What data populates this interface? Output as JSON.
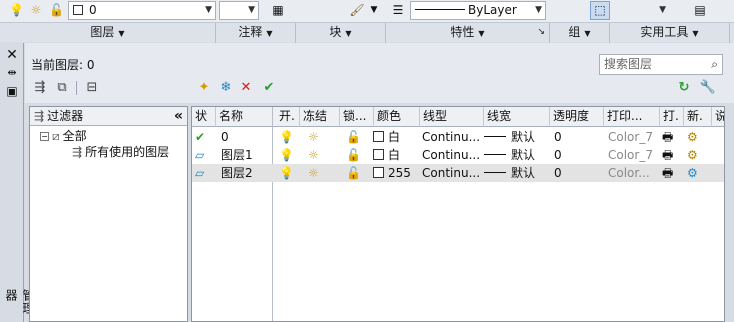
{
  "ribbon": {
    "layer_dropdown_value": "0",
    "linetype_value": "ByLayer",
    "sections": {
      "layers": "图层",
      "annotation": "注释",
      "block": "块",
      "properties": "特性",
      "groups": "组",
      "utilities": "实用工具"
    }
  },
  "manager": {
    "current_layer": "当前图层: 0",
    "search_placeholder": "搜索图层",
    "side_title": "图层特性管理器"
  },
  "filter_tree": {
    "header": "过滤器",
    "collapse": "«",
    "nodes": [
      {
        "label": "全部",
        "expander": "−"
      },
      {
        "label": "所有使用的图层"
      }
    ]
  },
  "layer_table": {
    "columns": [
      "状",
      "名称",
      "开.",
      "冻结",
      "锁...",
      "颜色",
      "线型",
      "线宽",
      "透明度",
      "打印...",
      "打.",
      "新.",
      "说"
    ],
    "rows": [
      {
        "status": "current",
        "name": "0",
        "color": "白",
        "linetype": "Continu...",
        "lineweight": "默认",
        "transparency": "0",
        "plot_style": "Color_7"
      },
      {
        "status": "normal",
        "name": "图层1",
        "color": "白",
        "linetype": "Continu...",
        "lineweight": "默认",
        "transparency": "0",
        "plot_style": "Color_7"
      },
      {
        "status": "normal",
        "name": "图层2",
        "color": "255",
        "linetype": "Continu...",
        "lineweight": "默认",
        "transparency": "0",
        "plot_style": "Color..."
      }
    ]
  },
  "colors": {
    "accent": "#1e88c8",
    "check_green": "#2aa02a",
    "delete_red": "#d02020",
    "selected_row": "#e3e3e3"
  }
}
